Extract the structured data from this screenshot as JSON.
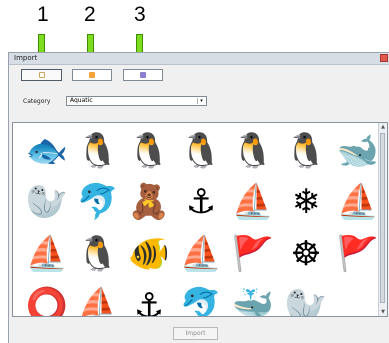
{
  "callouts": [
    "1",
    "2",
    "3"
  ],
  "window": {
    "title": "Import"
  },
  "tabs": [
    {
      "name": "tab-1",
      "icon": "card-icon",
      "color": "#c9a85b"
    },
    {
      "name": "tab-2",
      "icon": "folder-icon",
      "color": "#f3a33a"
    },
    {
      "name": "tab-3",
      "icon": "disk-icon",
      "color": "#8a7fd0"
    }
  ],
  "category": {
    "label": "Category",
    "value": "Aquatic",
    "arrow": "▾"
  },
  "grid": {
    "rows": [
      [
        {
          "name": "fish-embroidery",
          "glyph": "🐟"
        },
        {
          "name": "penguin-embroidery",
          "glyph": "🐧"
        },
        {
          "name": "penguin-embroidery",
          "glyph": "🐧"
        },
        {
          "name": "penguin-embroidery",
          "glyph": "🐧"
        },
        {
          "name": "penguin-embroidery",
          "glyph": "🐧"
        },
        {
          "name": "penguin-embroidery",
          "glyph": "🐧"
        },
        {
          "name": "whale-embroidery",
          "glyph": "🐋"
        }
      ],
      [
        {
          "name": "seal-embroidery",
          "glyph": "🦭"
        },
        {
          "name": "dolphin-embroidery",
          "glyph": "🐬"
        },
        {
          "name": "sailor-bear-embroidery",
          "glyph": "🧸"
        },
        {
          "name": "anchor-embroidery",
          "glyph": "⚓"
        },
        {
          "name": "sailboat-embroidery",
          "glyph": "⛵"
        },
        {
          "name": "snowflake-embroidery",
          "glyph": "❄"
        },
        {
          "name": "sailboat-embroidery",
          "glyph": "⛵"
        }
      ],
      [
        {
          "name": "sailboat-embroidery",
          "glyph": "⛵"
        },
        {
          "name": "penguin-embroidery",
          "glyph": "🐧"
        },
        {
          "name": "fish-embroidery",
          "glyph": "🐠"
        },
        {
          "name": "sailboat-embroidery",
          "glyph": "⛵"
        },
        {
          "name": "nautical-flag-embroidery",
          "glyph": "🚩"
        },
        {
          "name": "ship-wheel-embroidery",
          "glyph": "☸"
        },
        {
          "name": "nautical-flag-embroidery",
          "glyph": "🚩"
        }
      ],
      [
        {
          "name": "life-ring-embroidery",
          "glyph": "⭕"
        },
        {
          "name": "sailboat-embroidery",
          "glyph": "⛵"
        },
        {
          "name": "anchor-embroidery",
          "glyph": "⚓"
        },
        {
          "name": "dolphin-embroidery",
          "glyph": "🐬"
        },
        {
          "name": "whale-embroidery",
          "glyph": "🐳"
        },
        {
          "name": "walrus-embroidery",
          "glyph": "🦭"
        },
        {
          "name": "blank-cell",
          "glyph": ""
        }
      ]
    ]
  },
  "scroll": {
    "up": "▲",
    "down": "▼"
  },
  "import_button": "Import"
}
